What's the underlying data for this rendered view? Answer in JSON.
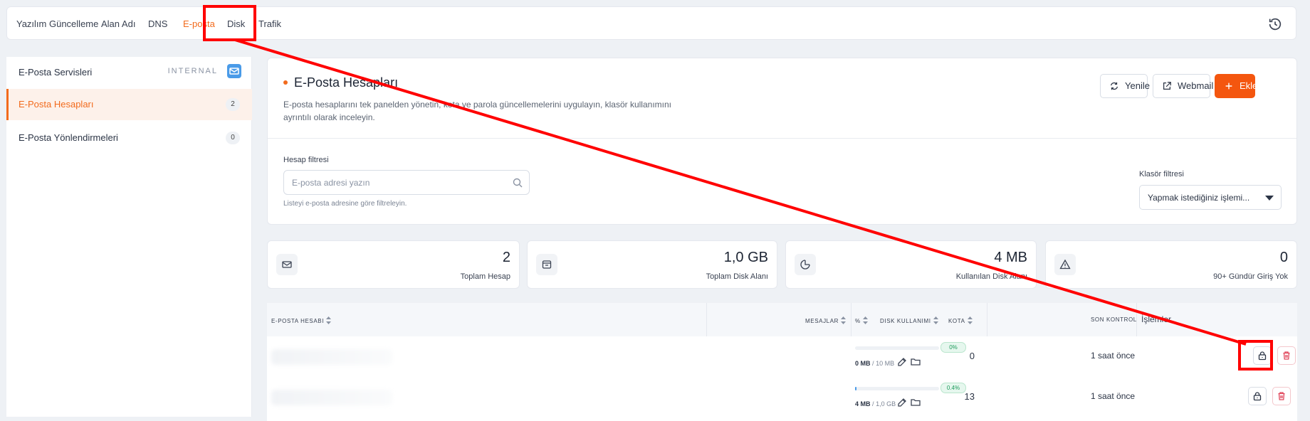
{
  "topnav": {
    "tabs": [
      {
        "label": "Yazılım Güncelleme"
      },
      {
        "label": "Alan Adı"
      },
      {
        "label": "DNS"
      },
      {
        "label": "E-posta"
      },
      {
        "label": "Disk"
      },
      {
        "label": "Trafik"
      }
    ],
    "active_tab": "E-posta",
    "history_icon": "history-icon"
  },
  "sidebar": {
    "items": [
      {
        "label": "E-Posta Servisleri",
        "tag": "INTERNAL",
        "icon": "mail-icon"
      },
      {
        "label": "E-Posta Hesapları",
        "count": "2"
      },
      {
        "label": "E-Posta Yönlendirmeleri",
        "count": "0"
      }
    ],
    "active_item": "E-Posta Hesapları"
  },
  "header": {
    "title": "E-Posta Hesapları",
    "description": "E-posta hesaplarını tek panelden yönetin, kota ve parola güncellemelerini uygulayın, klasör kullanımını ayrıntılı olarak inceleyin.",
    "buttons": {
      "refresh": "Yenile",
      "webmail": "Webmail",
      "add": "Ekle"
    },
    "filter": {
      "label": "Hesap filtresi",
      "placeholder": "E-posta adresi yazın",
      "hint": "Listeyi e-posta adresine göre filtreleyin."
    },
    "folder_filter": {
      "label": "Klasör filtresi",
      "selected": "Yapmak istediğiniz işlemi..."
    }
  },
  "stats": [
    {
      "value": "2",
      "caption": "Toplam Hesap",
      "icon": "mail-icon"
    },
    {
      "value": "1,0 GB",
      "caption": "Toplam Disk Alanı",
      "icon": "storage-icon"
    },
    {
      "value": "4 MB",
      "caption": "Kullanılan Disk Alanı",
      "icon": "pie-chart-icon"
    },
    {
      "value": "0",
      "caption": "90+ Gündür Giriş Yok",
      "icon": "warning-icon"
    }
  ],
  "table": {
    "columns": {
      "account": "E-POSTA HESABI",
      "messages": "MESAJLAR",
      "percent": "%",
      "disk_usage": "DISK KULLANIMI",
      "quota": "KOTA",
      "last_check": "SON KONTROL",
      "actions": "İşlemler"
    },
    "rows": [
      {
        "messages": "0",
        "percent_label": "0%",
        "usage_fraction": 0.0,
        "used": "0 MB",
        "quota": "10 MB",
        "last_check": "1 saat önce"
      },
      {
        "messages": "13",
        "percent_label": "0.4%",
        "usage_fraction": 0.004,
        "used": "4 MB",
        "quota": "1,0 GB",
        "last_check": "1 saat önce"
      }
    ]
  },
  "colors": {
    "accent": "#f26b1d",
    "primary_button": "#f4560f",
    "annotation": "#ff0000"
  }
}
